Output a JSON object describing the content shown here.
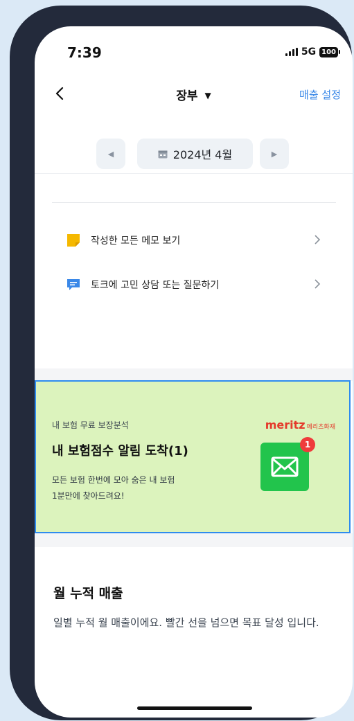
{
  "status": {
    "time": "7:39",
    "network": "5G",
    "battery": "100"
  },
  "navbar": {
    "title": "장부",
    "action": "매출 설정"
  },
  "month": {
    "label": "2024년 4월"
  },
  "menu": [
    {
      "label": "작성한 모든 메모 보기",
      "icon": "memo-note-icon",
      "color": "#f5b800"
    },
    {
      "label": "토크에 고민 상담 또는 질문하기",
      "icon": "chat-bubble-icon",
      "color": "#3a88e8"
    }
  ],
  "banner": {
    "sub": "내 보험 무료 보장분석",
    "title": "내 보험점수 알림 도착(1)",
    "desc_line1": "모든 보험 한번에 모아 숨은 내 보험",
    "desc_line2": "1분만에 찾아드려요!",
    "brand": "meritz",
    "brand_sub": "메리츠화재",
    "badge": "1",
    "bg_color": "#dcf3bd",
    "mail_color": "#22c44c"
  },
  "section": {
    "title": "월 누적 매출",
    "desc": "일별 누적 월 매출이에요. 빨간 선을 넘으면 목표 달성 입니다."
  },
  "colors": {
    "accent": "#3a88e8",
    "frame": "#232a3b",
    "background": "#dbe9f6"
  }
}
